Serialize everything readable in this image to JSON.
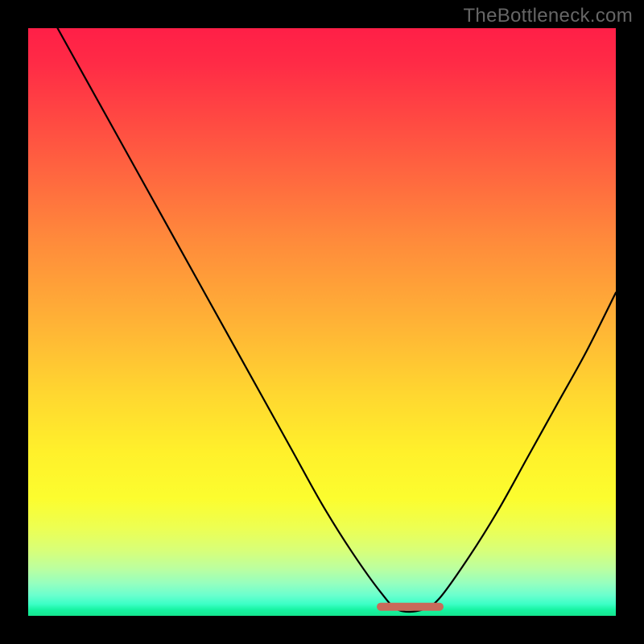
{
  "watermark": "TheBottleneck.com",
  "chart_data": {
    "type": "line",
    "title": "",
    "xlabel": "",
    "ylabel": "",
    "xlim": [
      0,
      100
    ],
    "ylim": [
      0,
      100
    ],
    "grid": false,
    "legend": false,
    "background": "vertical-gradient-red-to-green",
    "series": [
      {
        "name": "bottleneck-curve",
        "x": [
          5,
          10,
          15,
          20,
          25,
          30,
          35,
          40,
          45,
          50,
          55,
          60,
          63,
          67,
          70,
          75,
          80,
          85,
          90,
          95,
          100
        ],
        "y": [
          100,
          91,
          82,
          73,
          64,
          55,
          46,
          37,
          28,
          19,
          11,
          4,
          1,
          1,
          3,
          10,
          18,
          27,
          36,
          45,
          55
        ]
      }
    ],
    "annotations": [
      {
        "name": "optimal-flat-region",
        "kind": "highlight-segment",
        "color": "#c96a5a",
        "x_range": [
          60,
          70
        ],
        "y": 1
      }
    ]
  }
}
